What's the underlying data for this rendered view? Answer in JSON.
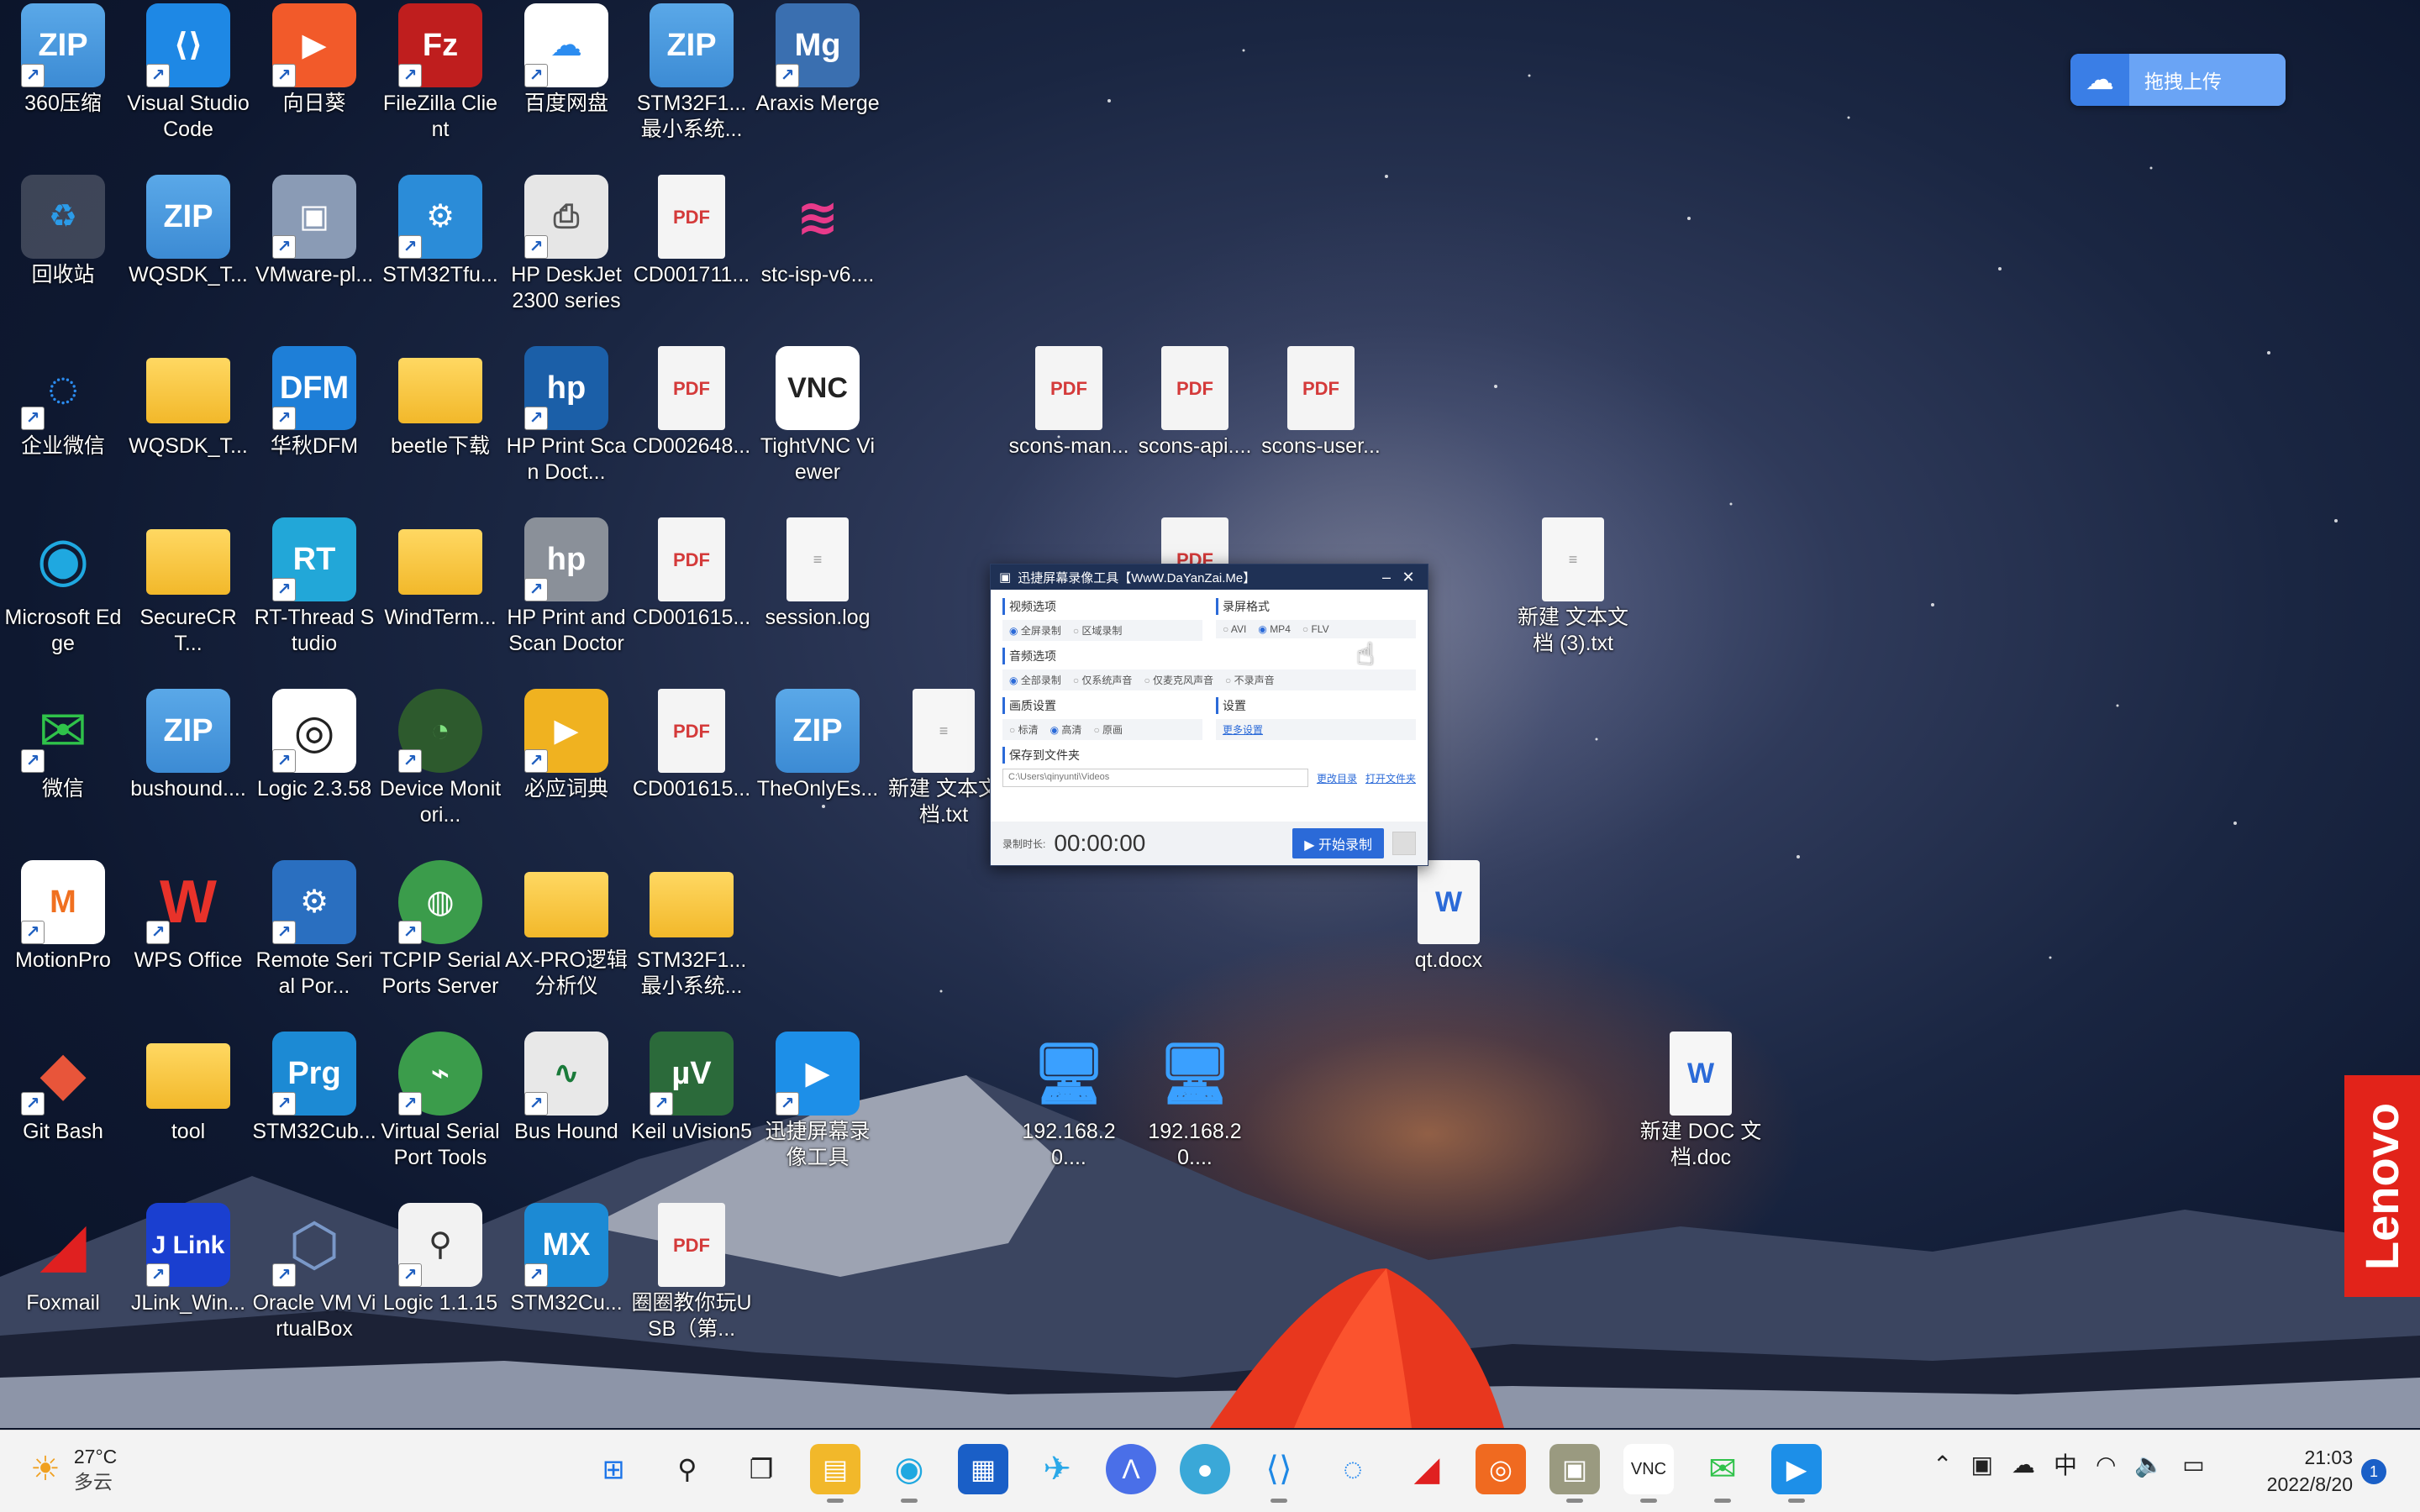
{
  "desktop_icons": {
    "i0": "360压缩",
    "i1": "Visual Studio Code",
    "i2": "向日葵",
    "i3": "FileZilla Client",
    "i4": "百度网盘",
    "i5": "STM32F1...最小系统...",
    "i6": "Araxis Merge",
    "i7": "回收站",
    "i8": "WQSDK_T...",
    "i9": "VMware-pl...",
    "i10": "STM32Tfu...",
    "i11": "HP DeskJet 2300 series",
    "i12": "CD001711...",
    "i13": "stc-isp-v6....",
    "i14": "企业微信",
    "i15": "WQSDK_T...",
    "i16": "华秋DFM",
    "i17": "beetle下载",
    "i18": "HP Print Scan Doct...",
    "i19": "CD002648...",
    "i20": "TightVNC Viewer",
    "i21": "scons-man...",
    "i22": "scons-api....",
    "i23": "scons-user...",
    "i24": "Microsoft Edge",
    "i25": "SecureCRT...",
    "i26": "RT-Thread Studio",
    "i27": "WindTerm...",
    "i28": "HP Print and Scan Doctor",
    "i29": "CD001615...",
    "i30": "session.log",
    "i31": "新建 文本文档 (3).txt",
    "i32": "微信",
    "i33": "bushound....",
    "i34": "Logic 2.3.58",
    "i35": "Device Monitori...",
    "i36": "必应词典",
    "i37": "CD001615...",
    "i38": "TheOnlyEs...",
    "i39": "新建 文本文档.txt",
    "i40": "MotionPro",
    "i41": "WPS Office",
    "i42": "Remote Serial Por...",
    "i43": "TCPIP Serial Ports Server",
    "i44": "AX-PRO逻辑分析仪",
    "i45": "STM32F1...最小系统...",
    "i46": "qt.docx",
    "i47": "Git Bash",
    "i48": "tool",
    "i49": "STM32Cub...",
    "i50": "Virtual Serial Port Tools",
    "i51": "Bus Hound",
    "i52": "Keil uVision5",
    "i53": "迅捷屏幕录像工具",
    "i54": "192.168.20....",
    "i55": "192.168.20....",
    "i56": "新建 DOC 文档.doc",
    "i57": "Foxmail",
    "i58": "JLink_Win...",
    "i59": "Oracle VM VirtualBox",
    "i60": "Logic 1.1.15",
    "i61": "STM32Cu...",
    "i62": "圈圈教你玩USB（第..."
  },
  "recorder": {
    "title": "迅捷屏幕录像工具【WwW.DaYanZai.Me】",
    "video_section": "视频选项",
    "video_full": "全屏录制",
    "video_region": "区域录制",
    "format_section": "录屏格式",
    "fmt_avi": "AVI",
    "fmt_mp4": "MP4",
    "fmt_flv": "FLV",
    "audio_section": "音频选项",
    "audio_all": "全部录制",
    "audio_system": "仅系统声音",
    "audio_mic": "仅麦克风声音",
    "audio_none": "不录声音",
    "quality_section": "画质设置",
    "q_standard": "标清",
    "q_high": "高清",
    "q_original": "原画",
    "settings_section": "设置",
    "more_settings": "更多设置",
    "save_section": "保存到文件夹",
    "save_path": "C:\\Users\\qinyunti\\Videos",
    "change_dir": "更改目录",
    "open_folder": "打开文件夹",
    "duration_label": "录制时长:",
    "duration": "00:00:00",
    "start_button": "开始录制"
  },
  "upload_widget": {
    "label": "拖拽上传"
  },
  "brand": {
    "lenovo": "Lenovo"
  },
  "taskbar": {
    "temperature": "27°C",
    "weather": "多云",
    "ime": "中",
    "time": "21:03",
    "date": "2022/8/20",
    "notifications": "1"
  }
}
